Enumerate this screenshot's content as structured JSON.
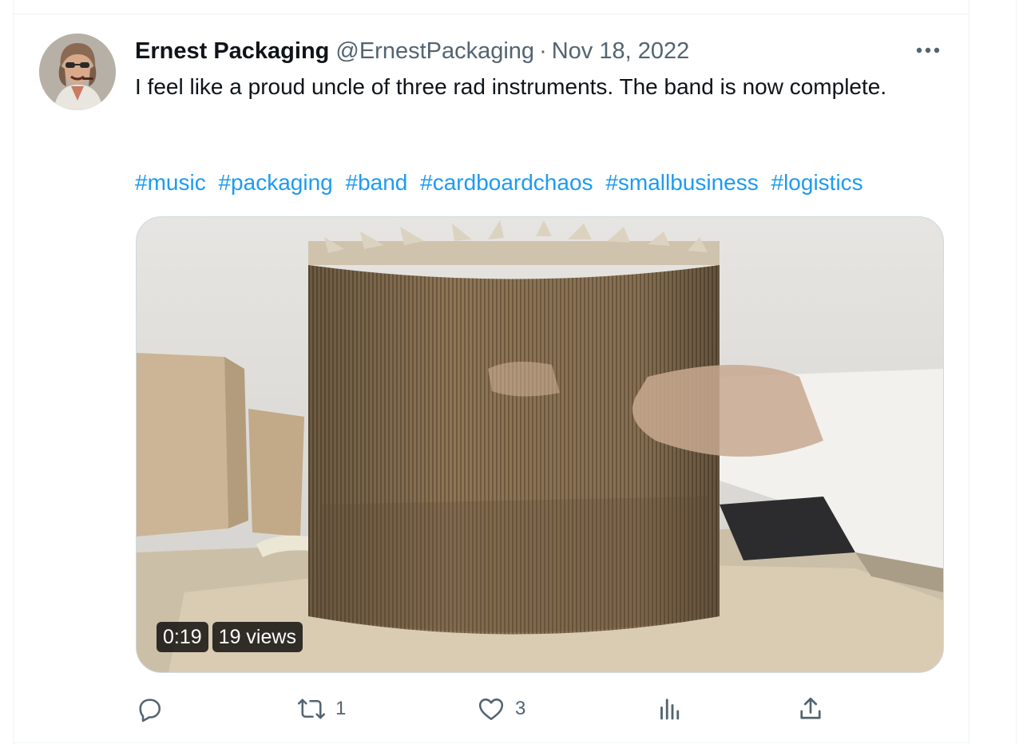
{
  "tweet": {
    "author_name": "Ernest Packaging",
    "handle": "@ErnestPackaging",
    "separator": "·",
    "date": "Nov 18, 2022",
    "text": "I feel like a proud uncle of three rad instruments. The band is now complete.",
    "hashtags": [
      "#music",
      "#packaging",
      "#band",
      "#cardboardchaos",
      "#smallbusiness",
      "#logistics"
    ],
    "media": {
      "type": "video",
      "duration": "0:19",
      "views": "19 views"
    },
    "actions": {
      "reply": {
        "icon": "reply-icon",
        "count": ""
      },
      "retweet": {
        "icon": "retweet-icon",
        "count": "1"
      },
      "like": {
        "icon": "heart-icon",
        "count": "3"
      },
      "views": {
        "icon": "analytics-icon",
        "count": ""
      },
      "share": {
        "icon": "share-icon",
        "count": ""
      }
    }
  },
  "colors": {
    "link": "#1d9bf0",
    "text_primary": "#0f1419",
    "text_secondary": "#536471",
    "border": "#eff3f4"
  }
}
